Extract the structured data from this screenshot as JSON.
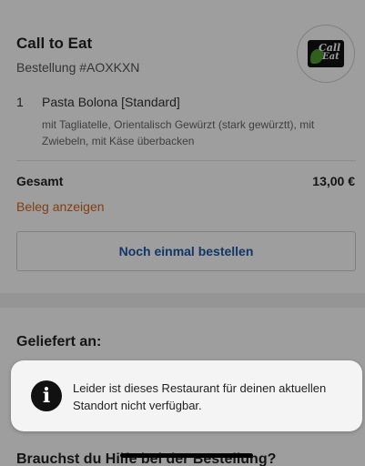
{
  "order": {
    "restaurant_name": "Call to Eat",
    "order_id": "Bestellung #AOXKXN",
    "logo_text_line1": "Call",
    "logo_text_line2": "Eat",
    "item": {
      "quantity": "1",
      "name": "Pasta Bolona [Standard]",
      "description": "mit Tagliatelle, Orientalisch Gewürzt (stark gewürztt), mit Zwiebeln, mit Käse überbacken"
    },
    "total_label": "Gesamt",
    "total_value": "13,00 €",
    "receipt_link": "Beleg anzeigen",
    "reorder_button": "Noch einmal bestellen"
  },
  "delivery": {
    "heading": "Geliefert an:"
  },
  "help": {
    "heading": "Brauchst du Hilfe bei der Bestellung?"
  },
  "toast": {
    "icon": "info-icon",
    "message": "Leider ist dieses Restaurant für deinen aktuellen Standort nicht verfügbar."
  },
  "colors": {
    "link": "#d2651f",
    "button_text": "#1e5aa8"
  }
}
